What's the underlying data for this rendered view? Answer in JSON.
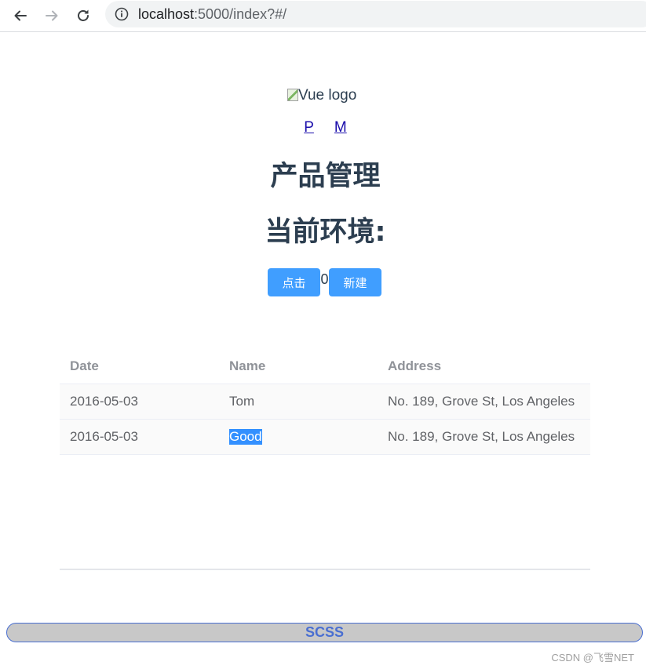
{
  "browser": {
    "url_host": "localhost",
    "url_rest": ":5000/index?#/",
    "icons": [
      "back-arrow-icon",
      "forward-arrow-icon",
      "reload-icon",
      "info-icon"
    ]
  },
  "app": {
    "logo_alt": "Vue logo",
    "nav": [
      {
        "label": "P"
      },
      {
        "label": "M"
      }
    ],
    "title": "产品管理",
    "env_label": "当前环境:",
    "click_button": "点击",
    "counter": "0",
    "new_button": "新建"
  },
  "table": {
    "columns": [
      "Date",
      "Name",
      "Address"
    ],
    "rows": [
      {
        "date": "2016-05-03",
        "name": "Tom",
        "address": "No. 189, Grove St, Los Angeles"
      },
      {
        "date": "2016-05-03",
        "name": "Good",
        "address": "No. 189, Grove St, Los Angeles"
      }
    ],
    "selected_text": "Good"
  },
  "footer": {
    "scss_label": "SCSS",
    "watermark": "CSDN @飞雪NET"
  },
  "colors": {
    "primary_button": "#409eff",
    "heading": "#2c3e50",
    "link": "#1a0dab",
    "scss_text": "#4a6fd1",
    "selection": "#3390ff"
  }
}
